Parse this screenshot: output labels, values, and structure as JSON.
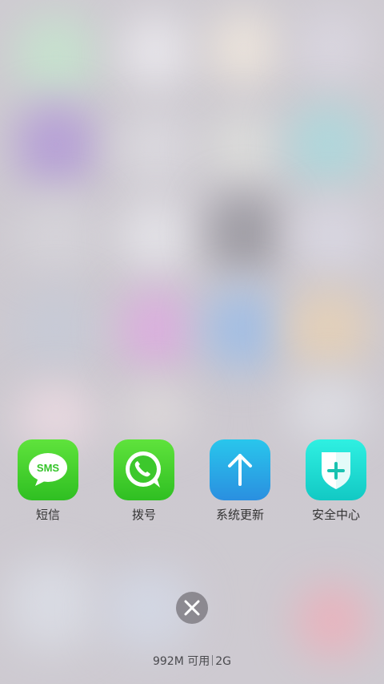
{
  "background": {
    "style": "blurred-home-screen"
  },
  "recent_apps": [
    {
      "label": "短信",
      "icon": "sms-icon",
      "badge_text": "SMS",
      "color_top": "#5fe33c",
      "color_bottom": "#2fbf22"
    },
    {
      "label": "拨号",
      "icon": "phone-icon",
      "color_top": "#5fe33c",
      "color_bottom": "#2fbf22"
    },
    {
      "label": "系统更新",
      "icon": "arrow-up-icon",
      "color_top": "#29c6ec",
      "color_bottom": "#2a8fe0"
    },
    {
      "label": "安全中心",
      "icon": "shield-plus-icon",
      "color_top": "#2ff0e2",
      "color_bottom": "#12c9c4"
    }
  ],
  "close_button": {
    "icon": "close-icon"
  },
  "memory": {
    "available": "992M 可用",
    "total": "2G"
  }
}
